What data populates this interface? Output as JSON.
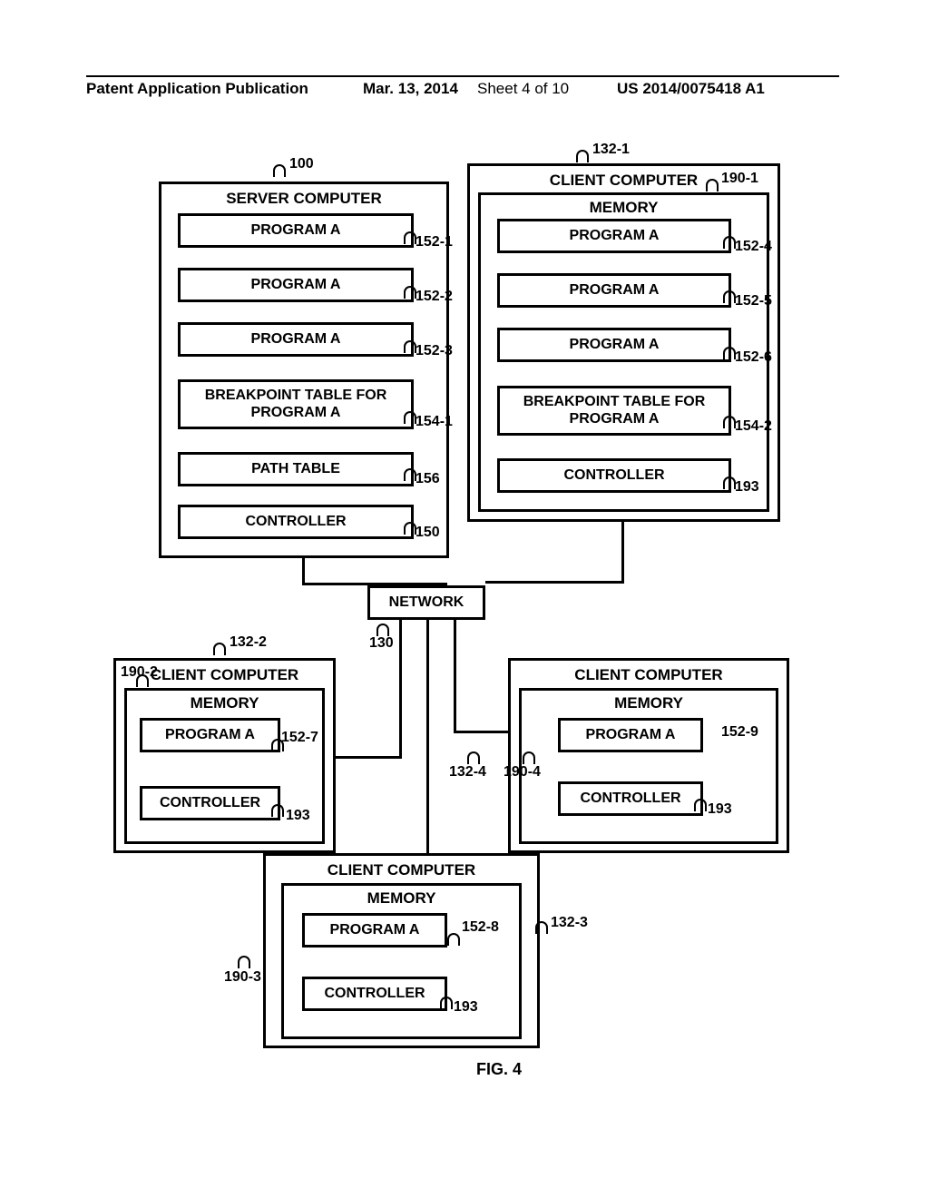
{
  "header": {
    "publication_label": "Patent Application Publication",
    "date": "Mar. 13, 2014",
    "sheet": "Sheet 4 of 10",
    "pub_number": "US 2014/0075418 A1"
  },
  "figure_label": "FIG. 4",
  "refs": {
    "server_100": "100",
    "client1_132_1": "132-1",
    "client1_190_1": "190-1",
    "prog_152_1": "152-1",
    "prog_152_2": "152-2",
    "prog_152_3": "152-3",
    "prog_152_4": "152-4",
    "prog_152_5": "152-5",
    "prog_152_6": "152-6",
    "prog_152_7": "152-7",
    "prog_152_8": "152-8",
    "prog_152_9": "152-9",
    "bp_154_1": "154-1",
    "bp_154_2": "154-2",
    "path_156": "156",
    "ctrl_150": "150",
    "ctrl_193": "193",
    "net_130": "130",
    "client2_132_2": "132-2",
    "client2_190_2": "190-2",
    "client3_132_3": "132-3",
    "client3_190_3": "190-3",
    "client4_132_4": "132-4",
    "client4_190_4": "190-4"
  },
  "labels": {
    "server_computer": "SERVER COMPUTER",
    "client_computer": "CLIENT COMPUTER",
    "memory": "MEMORY",
    "program_a": "PROGRAM A",
    "breakpoint_table": "BREAKPOINT TABLE FOR PROGRAM A",
    "path_table": "PATH TABLE",
    "controller": "CONTROLLER",
    "network": "NETWORK"
  }
}
